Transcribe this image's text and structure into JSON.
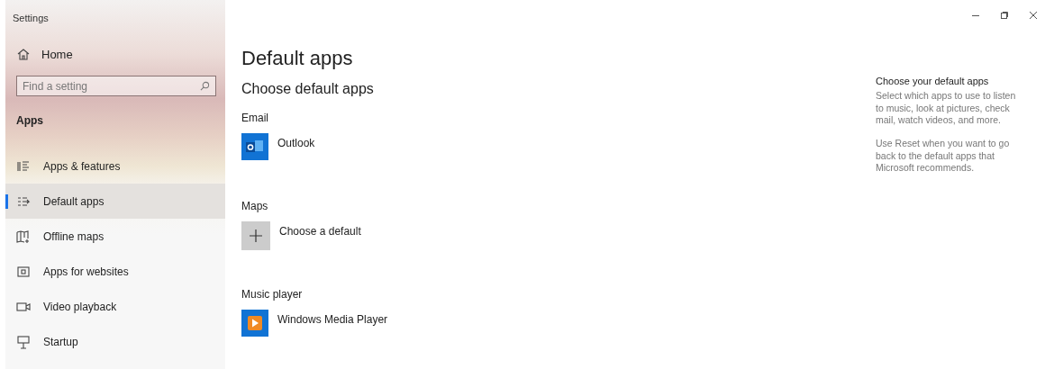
{
  "window": {
    "title": "Settings"
  },
  "sidebar": {
    "home": "Home",
    "search": {
      "placeholder": "Find a setting"
    },
    "section": "Apps",
    "items": [
      {
        "label": "Apps & features",
        "selected": false
      },
      {
        "label": "Default apps",
        "selected": true
      },
      {
        "label": "Offline maps",
        "selected": false
      },
      {
        "label": "Apps for websites",
        "selected": false
      },
      {
        "label": "Video playback",
        "selected": false
      },
      {
        "label": "Startup",
        "selected": false
      }
    ]
  },
  "page": {
    "title": "Default apps",
    "subtitle": "Choose default apps",
    "categories": [
      {
        "label": "Email",
        "app": {
          "kind": "app",
          "name": "Outlook"
        }
      },
      {
        "label": "Maps",
        "app": {
          "kind": "empty",
          "name": "Choose a default"
        }
      },
      {
        "label": "Music player",
        "app": {
          "kind": "app",
          "name": "Windows Media Player"
        }
      }
    ]
  },
  "help": {
    "title": "Choose your default apps",
    "paragraphs": [
      "Select which apps to use to listen to music, look at pictures, check mail, watch videos, and more.",
      "Use Reset when you want to go back to the default apps that Microsoft recommends."
    ]
  }
}
